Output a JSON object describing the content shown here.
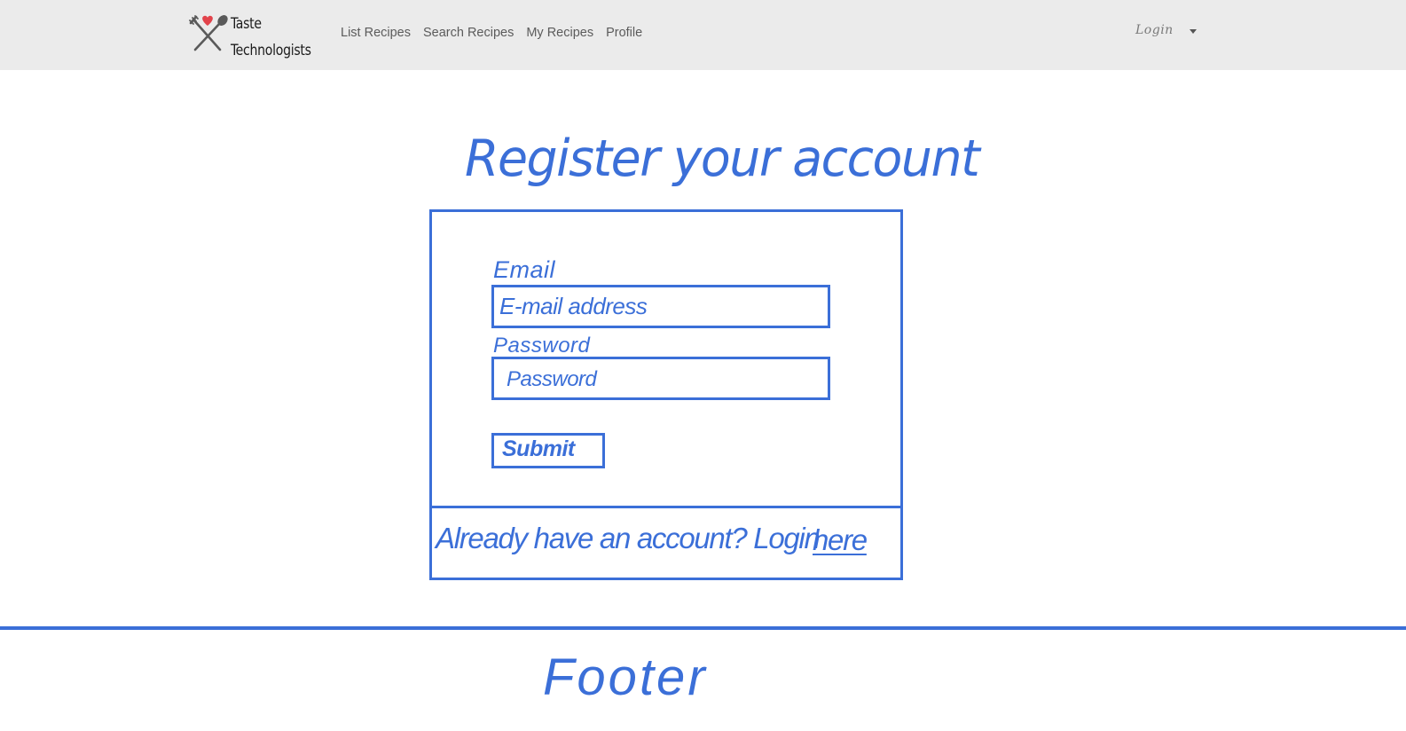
{
  "navbar": {
    "brand": {
      "line1": "Taste",
      "line2": "Technologists",
      "logo_icon": "fork-spoon-heart-icon"
    },
    "links": [
      {
        "label": "List Recipes"
      },
      {
        "label": "Search Recipes"
      },
      {
        "label": "My Recipes"
      },
      {
        "label": "Profile"
      }
    ],
    "login_dropdown": {
      "label": "Login",
      "icon": "caret-down-icon"
    }
  },
  "main": {
    "heading": "Register your account",
    "form": {
      "email_label": "Email",
      "email_placeholder": "E-mail address",
      "password_label": "Password",
      "password_placeholder": "Password",
      "submit_label": "Submit",
      "already_text": "Already have an account? Login",
      "here_link": "here"
    }
  },
  "footer": {
    "label": "Footer"
  },
  "colors": {
    "sketch_blue": "#3b6fd8",
    "navbar_bg": "#ebebeb",
    "heart_red": "#e2434b"
  }
}
